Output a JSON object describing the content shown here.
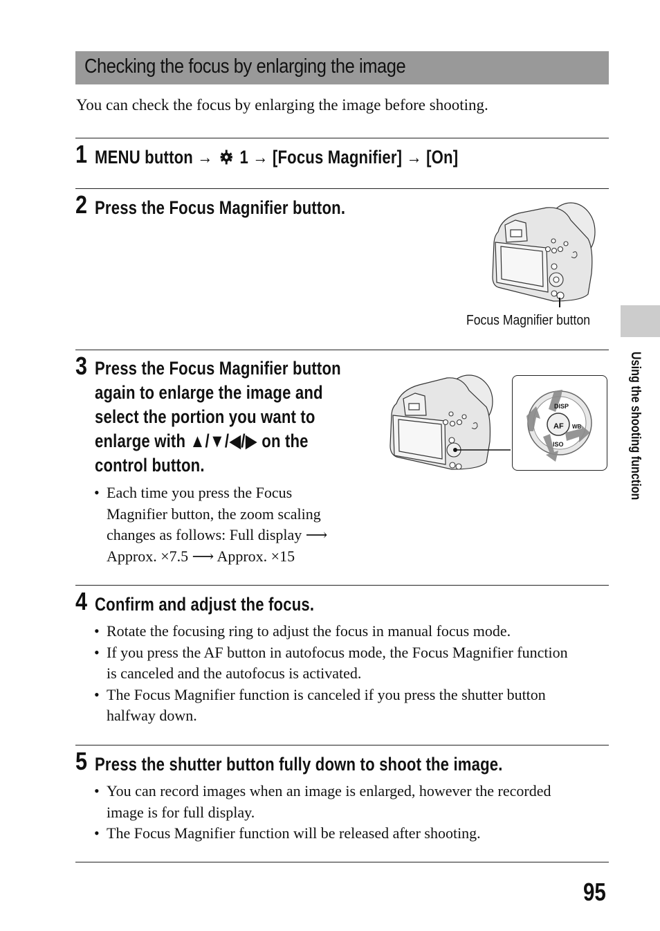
{
  "section": {
    "title": "Checking the focus by enlarging the image",
    "intro": "You can check the focus by enlarging the image before shooting."
  },
  "steps": [
    {
      "number": "1",
      "heading_parts": [
        "MENU button",
        "→",
        "gear-icon",
        "1",
        "→",
        "[Focus Magnifier]",
        "→",
        "[On]"
      ],
      "heading_menu": "MENU button",
      "heading_arrow": "→",
      "heading_tab": "1",
      "heading_item": "[Focus Magnifier]",
      "heading_value": "[On]"
    },
    {
      "number": "2",
      "heading": "Press the Focus Magnifier button.",
      "illustration": "camera-back-illustration",
      "caption": "Focus Magnifier button"
    },
    {
      "number": "3",
      "heading_lines": [
        "Press the Focus Magnifier button",
        "again to enlarge the image and",
        "select the portion you want to",
        "enlarge with ▲/▼/◀/▶ on the",
        "control button."
      ],
      "bullets": [
        {
          "lines": [
            "Each time you press the Focus",
            "Magnifier button, the zoom scaling",
            "changes as follows: Full display ⟶",
            "Approx. ×7.5 ⟶ Approx. ×15"
          ]
        }
      ],
      "illustration": "camera-control-button-illustration",
      "inset_labels": {
        "top": "DISP",
        "center": "AF",
        "right": "WB",
        "bottom": "ISO"
      }
    },
    {
      "number": "4",
      "heading": "Confirm and adjust the focus.",
      "bullets": [
        {
          "lines": [
            "Rotate the focusing ring to adjust the focus in manual focus mode."
          ]
        },
        {
          "lines": [
            "If you press the AF button in autofocus mode, the Focus Magnifier function",
            "is canceled and the autofocus is activated."
          ]
        },
        {
          "lines": [
            "The Focus Magnifier function is canceled if you press the shutter button",
            "halfway down."
          ]
        }
      ]
    },
    {
      "number": "5",
      "heading": "Press the shutter button fully down to shoot the image.",
      "bullets": [
        {
          "lines": [
            "You can record images when an image is enlarged, however the recorded",
            "image is for full display."
          ]
        },
        {
          "lines": [
            "The Focus Magnifier function will be released after shooting."
          ]
        }
      ]
    }
  ],
  "side_tab": {
    "label": "Using the shooting function"
  },
  "page_number": "95",
  "colors": {
    "section_bar": "#999999",
    "side_tab": "#cccccc",
    "text": "#111111"
  }
}
